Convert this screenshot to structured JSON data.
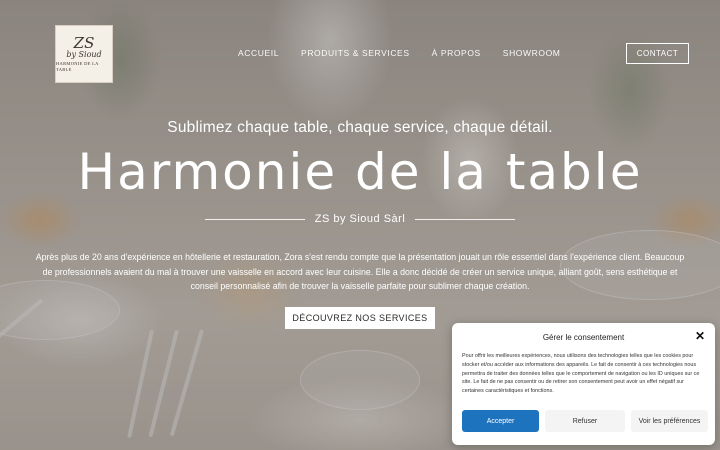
{
  "brand": {
    "logo_line1": "ZS",
    "logo_line2": "by Sioud",
    "logo_line3": "HARMONIE DE LA TABLE"
  },
  "nav": {
    "items": [
      "ACCUEIL",
      "PRODUITS & SERVICES",
      "À PROPOS",
      "SHOWROOM"
    ],
    "contact_label": "CONTACT"
  },
  "hero": {
    "tagline": "Sublimez chaque table, chaque service, chaque détail.",
    "title": "Harmonie de la table",
    "subtitle": "ZS by Sioud Sàrl",
    "paragraph": "Après plus de 20 ans d'expérience en hôtellerie et restauration, Zora s'est rendu compte que la présentation jouait un rôle essentiel dans l'expérience client. Beaucoup de professionnels avaient du mal à trouver une vaisselle en accord avec leur cuisine. Elle a donc décidé de créer un service unique, alliant goût, sens esthétique et conseil personnalisé afin de trouver la vaisselle parfaite pour sublimer chaque création.",
    "cta_label": "DÉCOUVREZ NOS SERVICES"
  },
  "consent": {
    "title": "Gérer le consentement",
    "body": "Pour offrir les meilleures expériences, nous utilisons des technologies telles que les cookies pour stocker et/ou accéder aux informations des appareils. Le fait de consentir à ces technologies nous permettra de traiter des données telles que le comportement de navigation ou les ID uniques sur ce site. Le fait de ne pas consentir ou de retirer son consentement peut avoir un effet négatif sur certaines caractéristiques et fonctions.",
    "accept_label": "Accepter",
    "refuse_label": "Refuser",
    "prefs_label": "Voir les préférences",
    "accent_color": "#1e73be"
  }
}
